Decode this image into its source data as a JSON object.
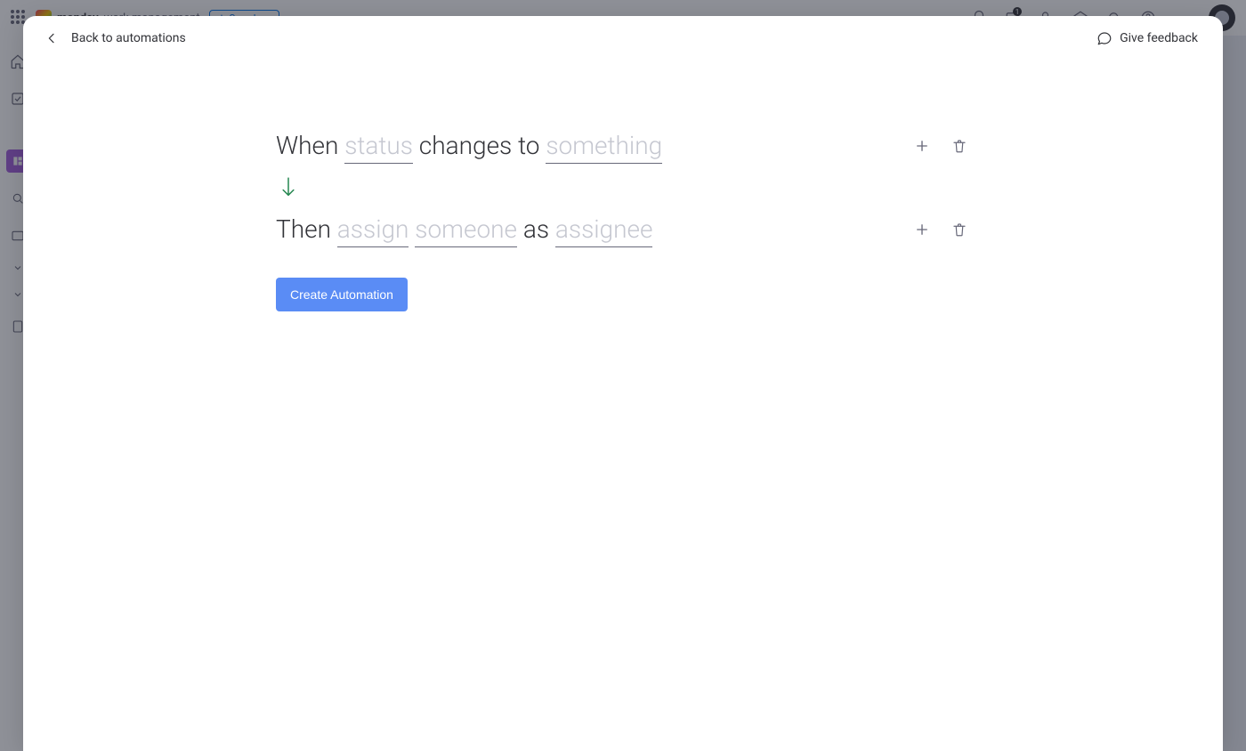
{
  "background": {
    "brand": "monday",
    "product_suffix": "work management",
    "see_plans_label": "See plans",
    "notification_count": "1"
  },
  "modal": {
    "back_label": "Back to automations",
    "feedback_label": "Give feedback"
  },
  "trigger": {
    "prefix": "When ",
    "slot_column": "status",
    "middle": " changes to ",
    "slot_value": "something"
  },
  "action": {
    "prefix": "Then ",
    "slot_verb": "assign",
    "space1": " ",
    "slot_person": "someone",
    "middle": " as ",
    "slot_role": "assignee"
  },
  "create_button_label": "Create Automation"
}
